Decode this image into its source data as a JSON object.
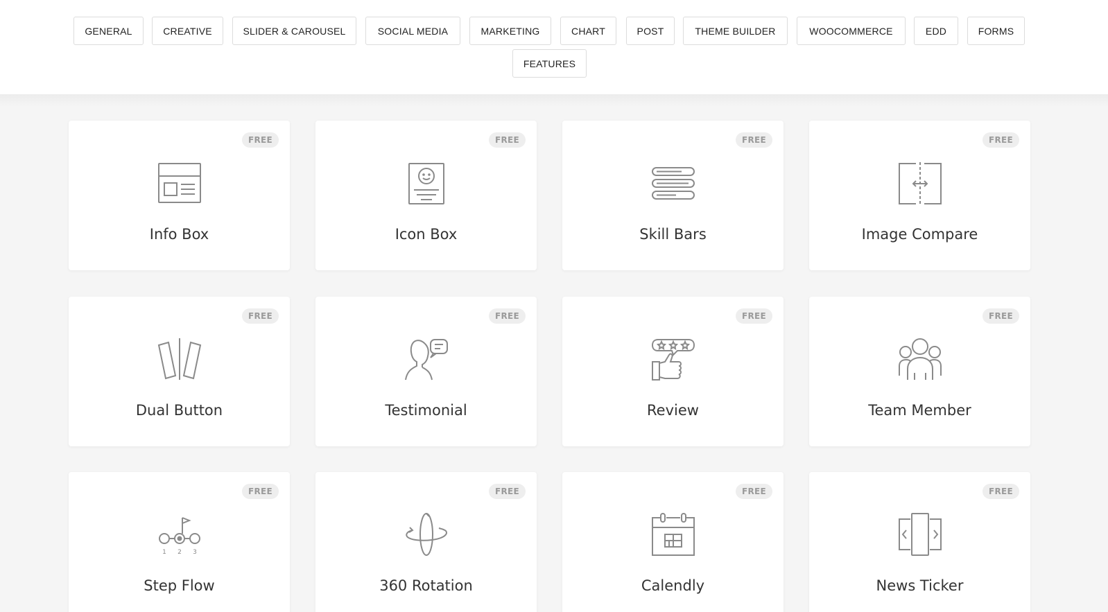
{
  "filters": [
    "GENERAL",
    "CREATIVE",
    "SLIDER & CAROUSEL",
    "SOCIAL MEDIA",
    "MARKETING",
    "CHART",
    "POST",
    "THEME BUILDER",
    "WOOCOMMERCE",
    "EDD",
    "FORMS",
    "FEATURES"
  ],
  "widgets": [
    {
      "title": "Info Box",
      "badge": "FREE",
      "icon": "info-box-icon"
    },
    {
      "title": "Icon Box",
      "badge": "FREE",
      "icon": "icon-box-icon"
    },
    {
      "title": "Skill Bars",
      "badge": "FREE",
      "icon": "skill-bars-icon"
    },
    {
      "title": "Image Compare",
      "badge": "FREE",
      "icon": "image-compare-icon"
    },
    {
      "title": "Dual Button",
      "badge": "FREE",
      "icon": "dual-button-icon"
    },
    {
      "title": "Testimonial",
      "badge": "FREE",
      "icon": "testimonial-icon"
    },
    {
      "title": "Review",
      "badge": "FREE",
      "icon": "review-icon"
    },
    {
      "title": "Team Member",
      "badge": "FREE",
      "icon": "team-member-icon"
    },
    {
      "title": "Step Flow",
      "badge": "FREE",
      "icon": "step-flow-icon",
      "step_numbers": [
        "1",
        "2",
        "3"
      ]
    },
    {
      "title": "360 Rotation",
      "badge": "FREE",
      "icon": "360-rotation-icon"
    },
    {
      "title": "Calendly",
      "badge": "FREE",
      "icon": "calendly-icon"
    },
    {
      "title": "News Ticker",
      "badge": "FREE",
      "icon": "news-ticker-icon"
    }
  ],
  "colors": {
    "icon_stroke": "#8a8a8a",
    "badge_bg": "#eeeeee",
    "badge_text": "#9a9a9a",
    "page_bg": "#f5f5f5"
  }
}
